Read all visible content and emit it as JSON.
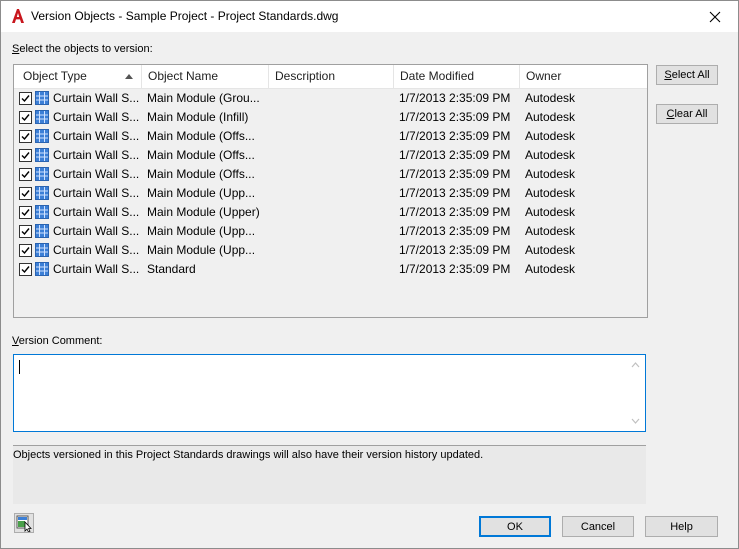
{
  "window": {
    "title": "Version Objects - Sample Project - Project Standards.dwg",
    "app_icon": "autocad-a-icon",
    "close_glyph": "✕"
  },
  "select_label": {
    "accel": "S",
    "rest": "elect the objects to version:"
  },
  "table": {
    "columns": [
      "Object Type",
      "Object Name",
      "Description",
      "Date Modified",
      "Owner"
    ],
    "sort_column": "Object Type",
    "sort_direction": "ascending",
    "rows": [
      {
        "checked": true,
        "type": "Curtain Wall S...",
        "name": "Main Module (Grou...",
        "description": "",
        "date": "1/7/2013 2:35:09 PM",
        "owner": "Autodesk"
      },
      {
        "checked": true,
        "type": "Curtain Wall S...",
        "name": "Main Module (Infill)",
        "description": "",
        "date": "1/7/2013 2:35:09 PM",
        "owner": "Autodesk"
      },
      {
        "checked": true,
        "type": "Curtain Wall S...",
        "name": "Main Module (Offs...",
        "description": "",
        "date": "1/7/2013 2:35:09 PM",
        "owner": "Autodesk"
      },
      {
        "checked": true,
        "type": "Curtain Wall S...",
        "name": "Main Module (Offs...",
        "description": "",
        "date": "1/7/2013 2:35:09 PM",
        "owner": "Autodesk"
      },
      {
        "checked": true,
        "type": "Curtain Wall S...",
        "name": "Main Module (Offs...",
        "description": "",
        "date": "1/7/2013 2:35:09 PM",
        "owner": "Autodesk"
      },
      {
        "checked": true,
        "type": "Curtain Wall S...",
        "name": "Main Module (Upp...",
        "description": "",
        "date": "1/7/2013 2:35:09 PM",
        "owner": "Autodesk"
      },
      {
        "checked": true,
        "type": "Curtain Wall S...",
        "name": "Main Module (Upper)",
        "description": "",
        "date": "1/7/2013 2:35:09 PM",
        "owner": "Autodesk"
      },
      {
        "checked": true,
        "type": "Curtain Wall S...",
        "name": "Main Module (Upp...",
        "description": "",
        "date": "1/7/2013 2:35:09 PM",
        "owner": "Autodesk"
      },
      {
        "checked": true,
        "type": "Curtain Wall S...",
        "name": "Main Module (Upp...",
        "description": "",
        "date": "1/7/2013 2:35:09 PM",
        "owner": "Autodesk"
      },
      {
        "checked": true,
        "type": "Curtain Wall S...",
        "name": "Standard",
        "description": "",
        "date": "1/7/2013 2:35:09 PM",
        "owner": "Autodesk"
      }
    ]
  },
  "buttons": {
    "select_all": {
      "accel": "S",
      "rest": "elect All"
    },
    "clear_all": {
      "accel": "C",
      "rest": "lear All"
    },
    "ok": "OK",
    "cancel": "Cancel",
    "help": "Help"
  },
  "comment": {
    "label_accel": "V",
    "label_rest": "ersion Comment:",
    "value": ""
  },
  "info_text": "Objects versioned in this Project Standards drawings will also have their version history updated.",
  "colors": {
    "accent": "#0078d7",
    "autocad_red": "#c8161d",
    "object_icon_blue": "#3c7fd6"
  }
}
